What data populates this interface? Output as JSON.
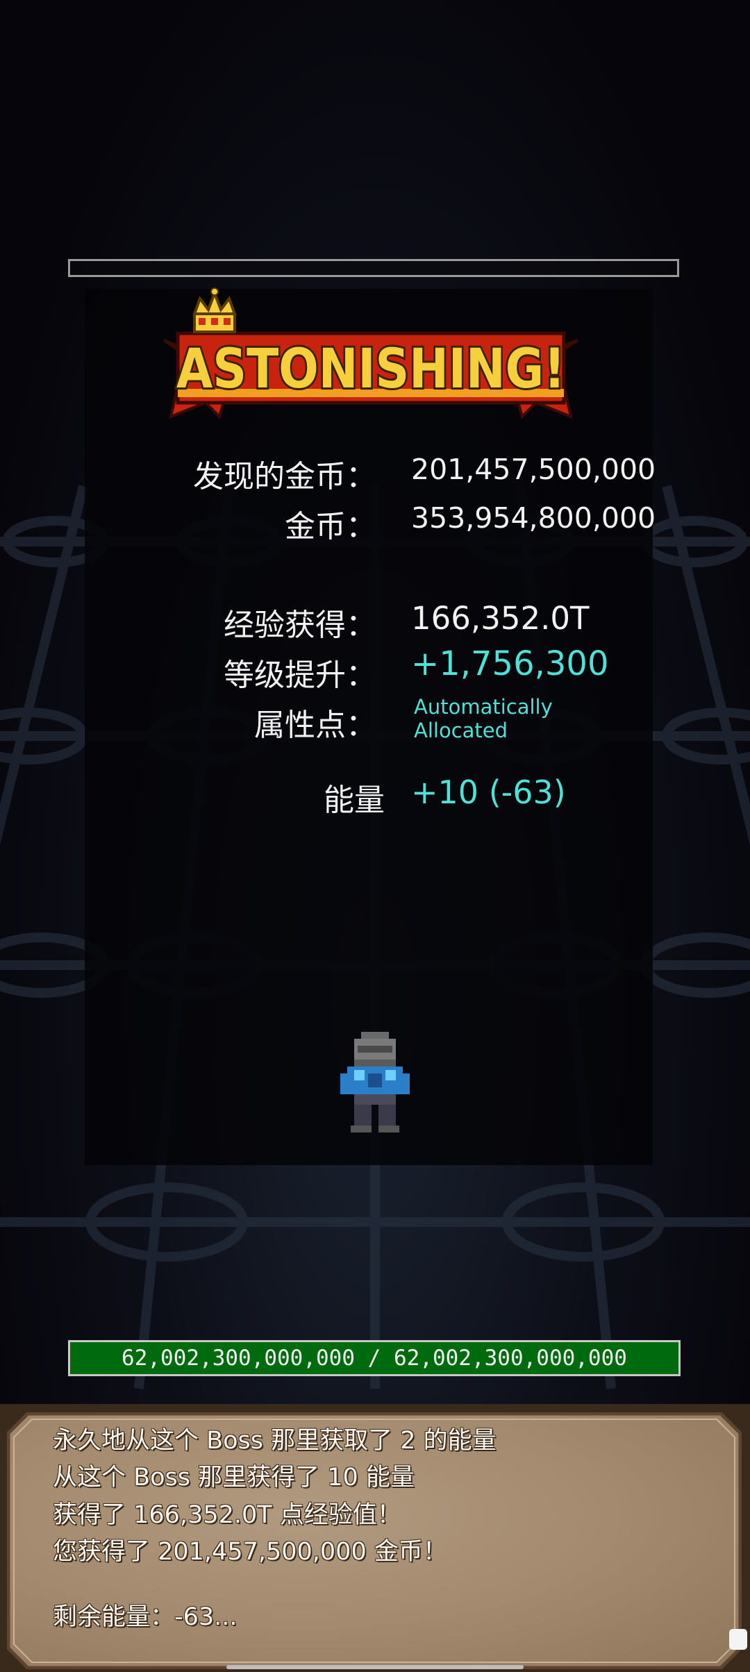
{
  "result": {
    "banner_text": "ASTONISHING!",
    "gold_found_label": "发现的金币：",
    "gold_found_value": "201,457,500,000",
    "gold_label": "金币：",
    "gold_value": "353,954,800,000",
    "exp_label": "经验获得：",
    "exp_value": "166,352.0T",
    "level_label": "等级提升：",
    "level_value": "+1,756,300",
    "attr_label": "属性点：",
    "attr_value_line1": "Automatically",
    "attr_value_line2": "Allocated",
    "energy_label": "能量",
    "energy_value": "+10 (-63)"
  },
  "hp_bar": {
    "text": "62,002,300,000,000 / 62,002,300,000,000",
    "fill": 1.0
  },
  "dialog": {
    "messages": [
      "永久地从这个 Boss 那里获取了 2 的能量",
      "从这个 Boss 那里获得了 10 能量",
      "获得了 166,352.0T 点经验值！",
      "您获得了 201,457,500,000 金币！"
    ],
    "remaining": "剩余能量：-63..."
  },
  "icons": {
    "banner": "crown-banner-icon",
    "character": "armored-knight-sprite"
  },
  "colors": {
    "value_cyan": "#4fe0d6",
    "hp_green": "#006a0e",
    "banner_gold": "#f5cf3c",
    "banner_red": "#c8230e"
  }
}
